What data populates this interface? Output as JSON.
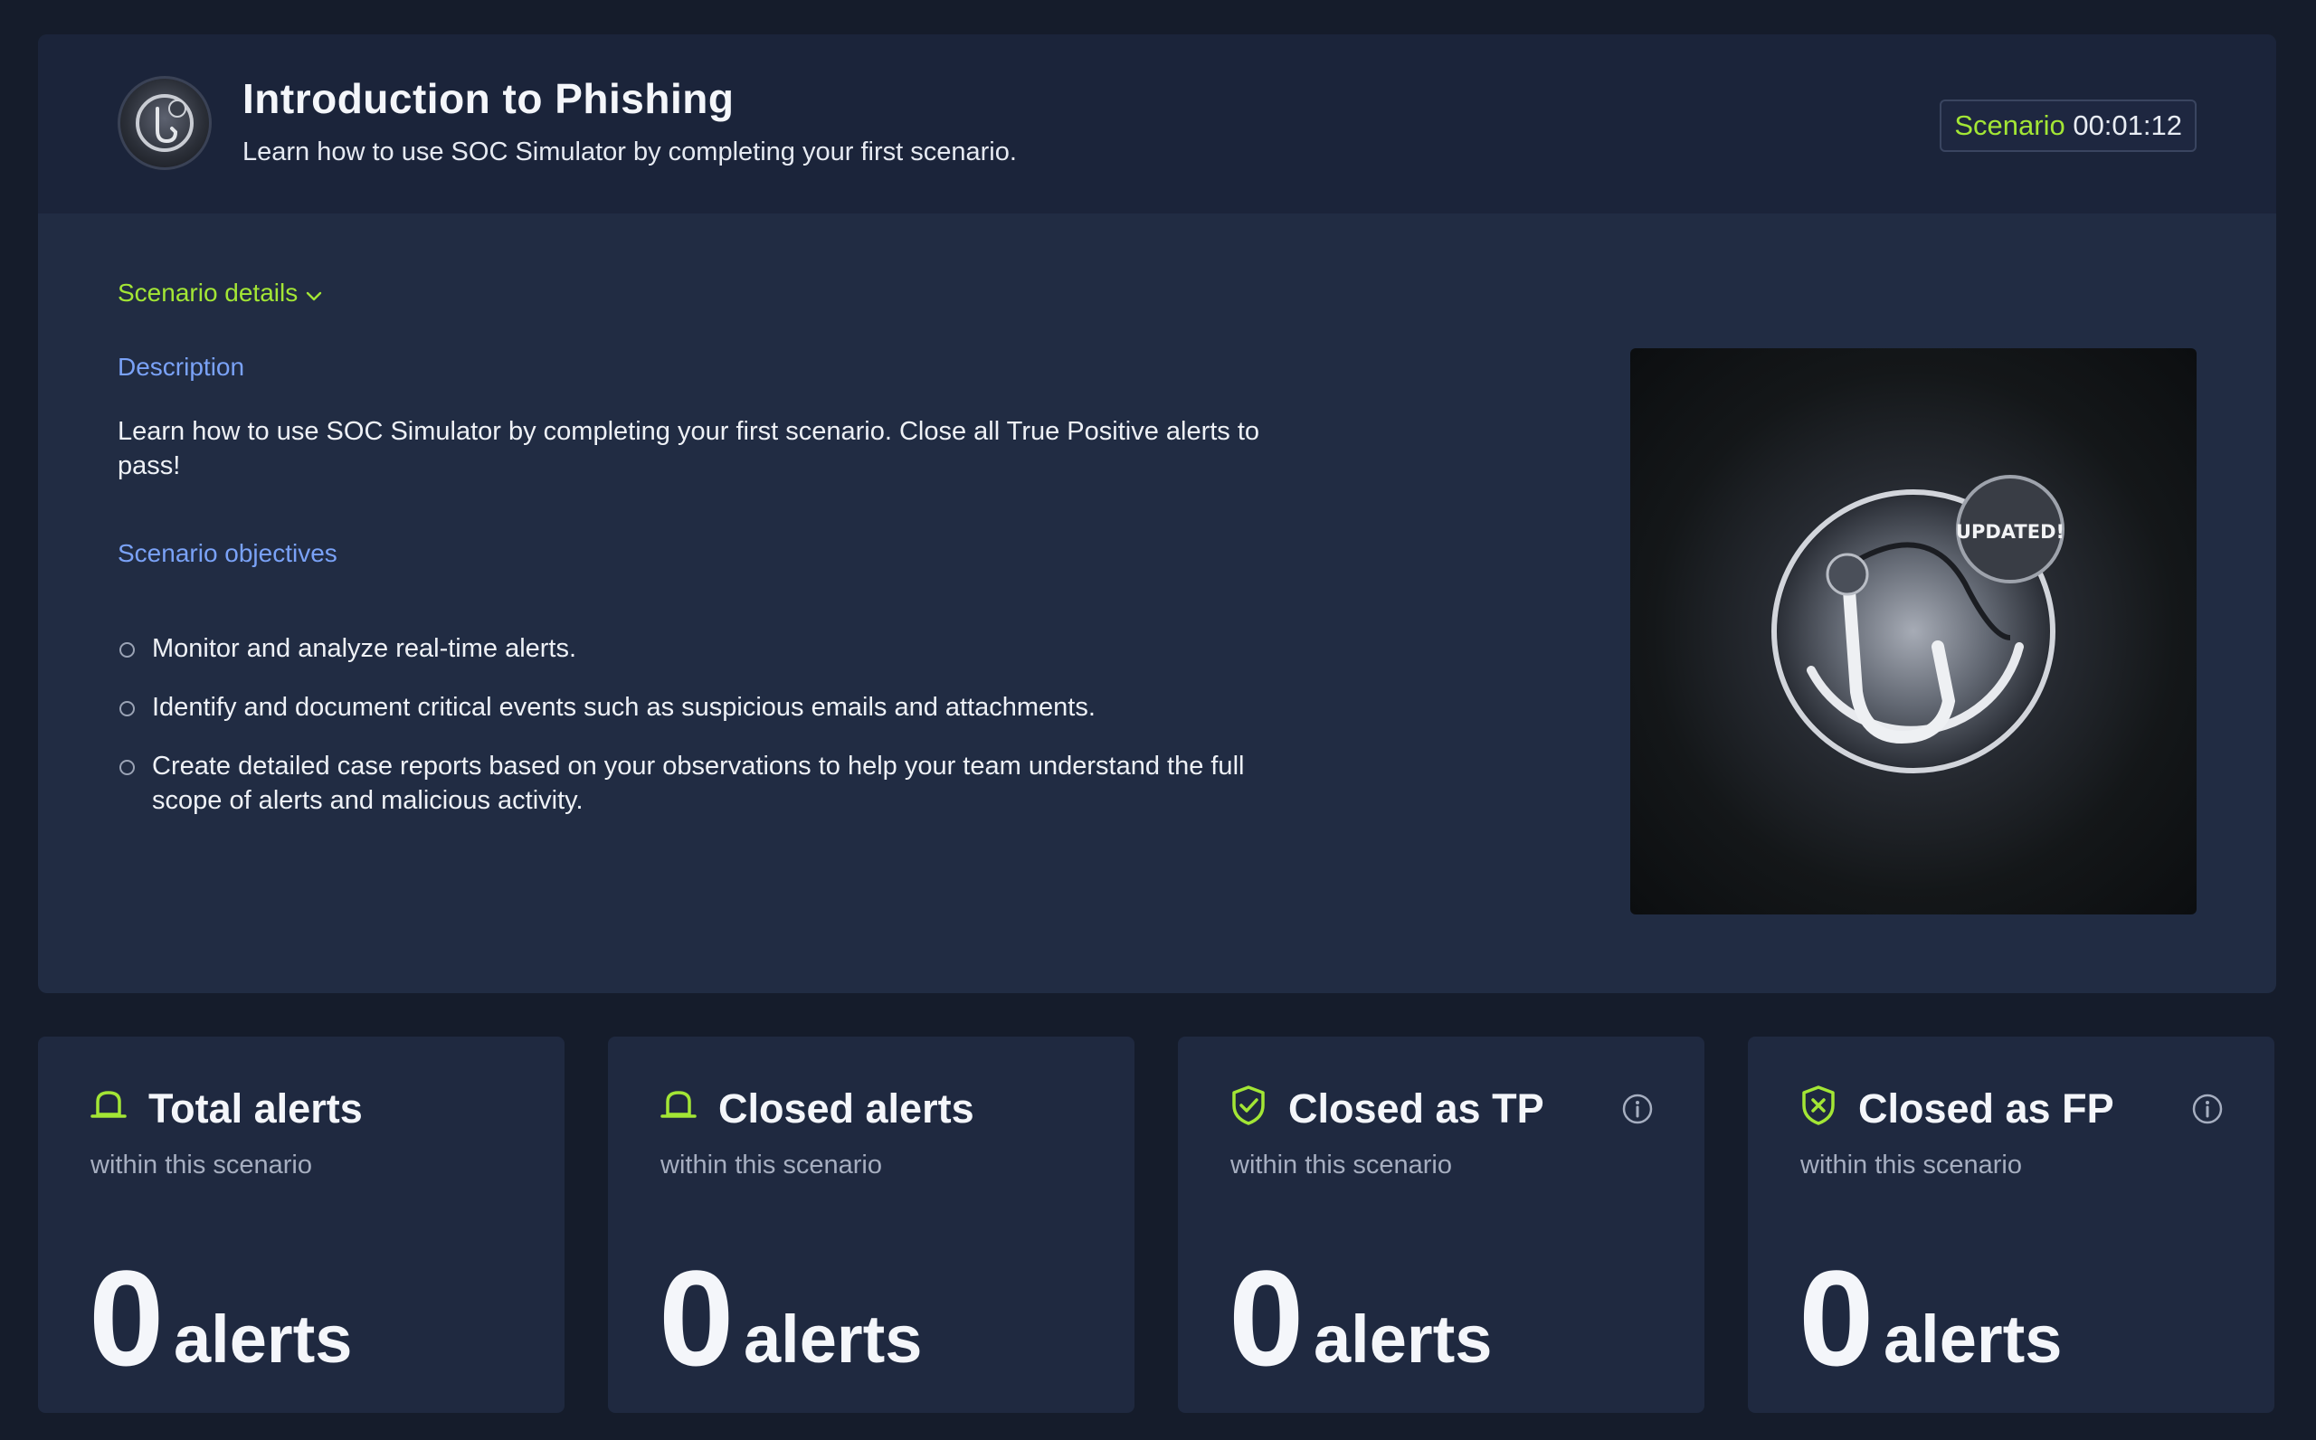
{
  "header": {
    "title": "Introduction to Phishing",
    "subtitle": "Learn how to use SOC Simulator by completing your first scenario.",
    "timer_label": "Scenario",
    "timer_value": "00:01:12",
    "logo_icon": "phishing-hook-icon"
  },
  "details": {
    "toggle_label": "Scenario details",
    "description_heading": "Description",
    "description_text": "Learn how to use SOC Simulator by completing your first scenario. Close all True Positive alerts to pass!",
    "objectives_heading": "Scenario objectives",
    "objectives": [
      "Monitor and analyze real-time alerts.",
      "Identify and document critical events such as suspicious emails and attachments.",
      "Create detailed case reports based on your observations to help your team understand the full scope of alerts and malicious activity."
    ],
    "image_badge": "UPDATED!"
  },
  "stats": [
    {
      "title": "Total alerts",
      "subtitle": "within this scenario",
      "value": "0",
      "unit": "alerts",
      "icon": "alarm-icon"
    },
    {
      "title": "Closed alerts",
      "subtitle": "within this scenario",
      "value": "0",
      "unit": "alerts",
      "icon": "alarm-icon"
    },
    {
      "title": "Closed as TP",
      "subtitle": "within this scenario",
      "value": "0",
      "unit": "alerts",
      "icon": "shield-check-icon"
    },
    {
      "title": "Closed as FP",
      "subtitle": "within this scenario",
      "value": "0",
      "unit": "alerts",
      "icon": "shield-x-icon"
    }
  ],
  "colors": {
    "accent": "#a3e635",
    "section_heading": "#7aa2f7",
    "card_bg": "#1f2940",
    "page_bg": "#151c2b"
  }
}
